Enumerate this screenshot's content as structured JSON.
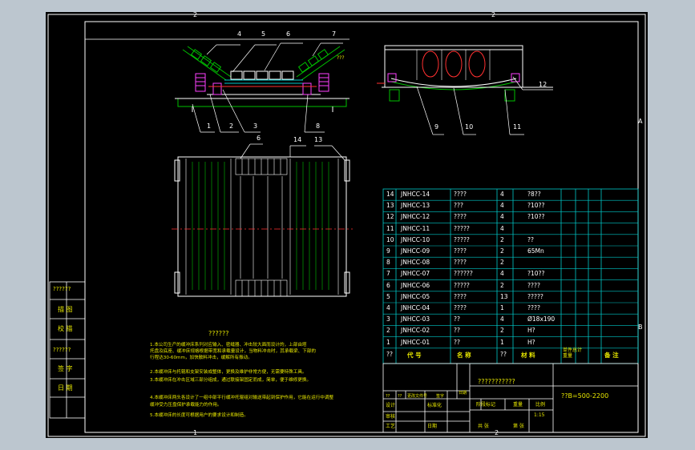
{
  "grid_labels": {
    "top_a": "2",
    "top_b": "2",
    "right_a": "A",
    "right_b": "B",
    "bottom_a": "1",
    "bottom_b": "2"
  },
  "callouts": [
    "4",
    "5",
    "6",
    "7",
    "1",
    "2",
    "3",
    "8",
    "9",
    "10",
    "11",
    "12",
    "6",
    "14",
    "13"
  ],
  "side_label": "???",
  "left_panel": [
    "??????",
    "描 图",
    "校 描",
    "??????",
    "签 字",
    "日 期"
  ],
  "notes_title": "??????",
  "notes": [
    "1.本公司生产的缓冲床系列对应输入、密缝器、冲击较大面而设计的，上部由塔",
    "    托盘及底座、缓冲床规格根据带宽和承载量设计，当物料冲击时，其承载梁、下部的",
    "    行程达30-60mm，加快散料冲击，缓解所有振动。",
    "2.本缓冲床与托辊和支架安装成整体，更换及维护非常方便，无需要特殊工具。",
    "3.本缓冲床在冲击区域三部分组成，通过联接架固定而成，简单，便于维修更换。",
    "4.本缓冲床两头各设计了一组中部平行缓冲托辊组对输送带起到保护作用，它能在运行中调整",
    "    缓冲受力压盘保护承载能力的作用。",
    "5.本缓冲床的长度可根据用户的要求设计和制造。"
  ],
  "bom": {
    "rows": [
      {
        "no": "14",
        "code": "JNHCC-14",
        "name": "????",
        "qty": "4",
        "mat": "?8??"
      },
      {
        "no": "13",
        "code": "JNHCC-13",
        "name": "???",
        "qty": "4",
        "mat": "?10??"
      },
      {
        "no": "12",
        "code": "JNHCC-12",
        "name": "????",
        "qty": "4",
        "mat": "?10??"
      },
      {
        "no": "11",
        "code": "JNHCC-11",
        "name": "?????",
        "qty": "4",
        "mat": ""
      },
      {
        "no": "10",
        "code": "JNHCC-10",
        "name": "?????",
        "qty": "2",
        "mat": "??"
      },
      {
        "no": "9",
        "code": "JNHCC-09",
        "name": "????",
        "qty": "2",
        "mat": "65Mn"
      },
      {
        "no": "8",
        "code": "JNHCC-08",
        "name": "????",
        "qty": "2",
        "mat": ""
      },
      {
        "no": "7",
        "code": "JNHCC-07",
        "name": "??????",
        "qty": "4",
        "mat": "?10??"
      },
      {
        "no": "6",
        "code": "JNHCC-06",
        "name": "?????",
        "qty": "2",
        "mat": "????"
      },
      {
        "no": "5",
        "code": "JNHCC-05",
        "name": "????",
        "qty": "13",
        "mat": "?????"
      },
      {
        "no": "4",
        "code": "JNHCC-04",
        "name": "????",
        "qty": "1",
        "mat": "????"
      },
      {
        "no": "3",
        "code": "JNHCC-03",
        "name": "??",
        "qty": "4",
        "mat": "Ø18x190"
      },
      {
        "no": "2",
        "code": "JNHCC-02",
        "name": "??",
        "qty": "2",
        "mat": "H?"
      },
      {
        "no": "1",
        "code": "JNHCC-01",
        "name": "??",
        "qty": "1",
        "mat": "H?"
      }
    ],
    "header": {
      "no": "??",
      "code": "代 号",
      "name": "名 称",
      "qty": "??",
      "mat": "材 料",
      "weight": "单件总计\n重量",
      "remark": "备 注"
    }
  },
  "title_block": {
    "drawing_title": "???????????",
    "drawing_number": "??B=500-2200",
    "labels": [
      "设计",
      "标准化",
      "审核",
      "工艺",
      "日期"
    ],
    "stage": "阶段标记",
    "weight_label": "重量",
    "scale_label": "比例",
    "scale_value": "1:15",
    "sheets": "共 张",
    "sheet_no": "第 张",
    "rev_header": [
      "??",
      "??",
      "更改文件号",
      "签字"
    ],
    "small_mark": "日期"
  },
  "colors": {
    "line": "#ffffff",
    "green": "#00c000",
    "cyan": "#00c8c8",
    "yellow": "#e8e800",
    "magenta": "#ff40ff",
    "red": "#ff3030",
    "blue": "#3a4cff"
  }
}
